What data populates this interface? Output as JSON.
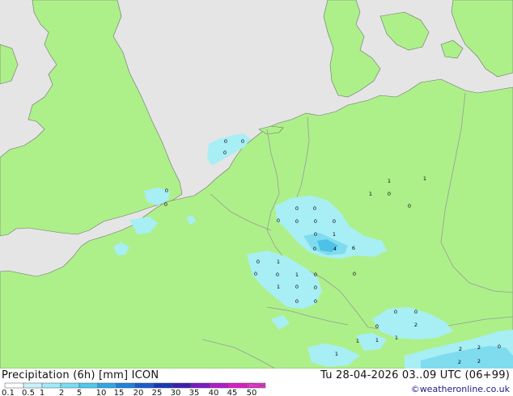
{
  "map": {
    "colors": {
      "sea": "#e5e5e5",
      "land": "#adf08a",
      "border": "#9a9a9a",
      "coast": "#6f6f6f",
      "precip_light": "#a8eef5",
      "precip_medium": "#7fdcef",
      "precip_strong": "#4cc2e6"
    },
    "precipitation_labels": [
      "0",
      "0",
      "0",
      "0",
      "0",
      "0",
      "0",
      "0",
      "0",
      "0",
      "0",
      "0",
      "1",
      "0",
      "4",
      "6",
      "1",
      "0",
      "1",
      "1",
      "0",
      "0",
      "1",
      "0",
      "0",
      "1",
      "0",
      "0",
      "1",
      "0",
      "0",
      "0",
      "0",
      "2",
      "0",
      "0",
      "1",
      "0",
      "1",
      "1",
      "2",
      "2",
      "2",
      "0",
      "1",
      "2"
    ]
  },
  "footer": {
    "title": "Precipitation (6h) [mm] ICON",
    "valid_time": "Tu 28-04-2026 03..09 UTC (06+99)",
    "credit": "©weatheronline.co.uk"
  },
  "legend": {
    "ticks": [
      "0.1",
      "0.5",
      "1",
      "2",
      "5",
      "10",
      "15",
      "20",
      "25",
      "30",
      "35",
      "40",
      "45",
      "50"
    ],
    "colors": [
      "#ffffff",
      "#c6f2fb",
      "#a0e9f8",
      "#78dcf4",
      "#4fc8ee",
      "#2ea7e6",
      "#1f82de",
      "#1a5ccf",
      "#1838b8",
      "#3d1fb0",
      "#7b1bc2",
      "#b01cc9",
      "#d81fc7",
      "#ef2fd8"
    ]
  }
}
